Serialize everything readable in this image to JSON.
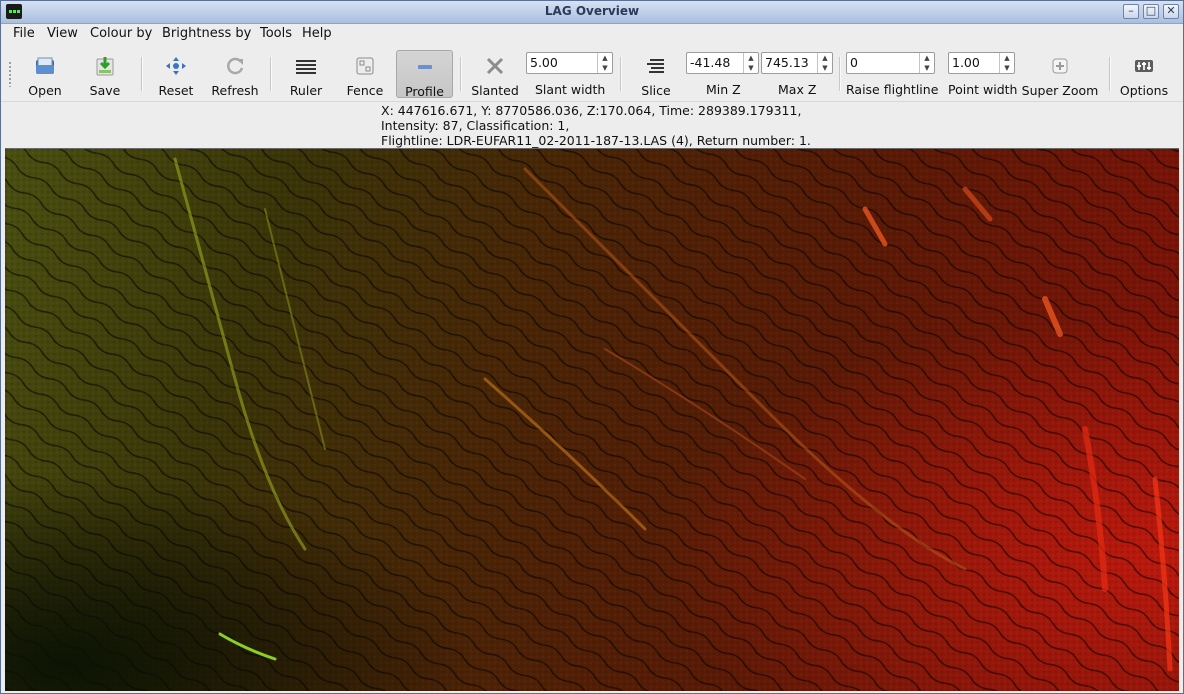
{
  "window": {
    "title": "LAG Overview",
    "minimize": "–",
    "maximize": "□",
    "close": "✕"
  },
  "menu": [
    "File",
    "View",
    "Colour by",
    "Brightness by",
    "Tools",
    "Help"
  ],
  "toolbar": {
    "open": "Open",
    "save": "Save",
    "reset": "Reset",
    "refresh": "Refresh",
    "ruler": "Ruler",
    "fence": "Fence",
    "profile": "Profile",
    "slanted": "Slanted",
    "slant_width_label": "Slant width",
    "slant_width_value": "5.00",
    "slice": "Slice",
    "min_z_label": "Min Z",
    "min_z_value": "-41.48",
    "max_z_label": "Max Z",
    "max_z_value": "745.13",
    "raise_flightline_label": "Raise flightline",
    "raise_flightline_value": "0",
    "point_width_label": "Point width",
    "point_width_value": "1.00",
    "super_zoom": "Super Zoom",
    "options": "Options"
  },
  "info": {
    "line1": "X: 447616.671, Y: 8770586.036, Z:170.064, Time: 289389.179311,",
    "line2": "Intensity: 87, Classification: 1,",
    "line3": "Flightline: LDR-EUFAR11_02-2011-187-13.LAS (4), Return number: 1."
  },
  "colors": {
    "low": "#7a8a18",
    "mid": "#8a4208",
    "high": "#c82010",
    "accent": "#e8551e"
  },
  "icons": [
    "open-icon",
    "save-icon",
    "reset-icon",
    "refresh-icon",
    "ruler-icon",
    "fence-icon",
    "profile-icon",
    "slanted-icon",
    "slice-icon",
    "super-zoom-icon",
    "options-icon"
  ]
}
